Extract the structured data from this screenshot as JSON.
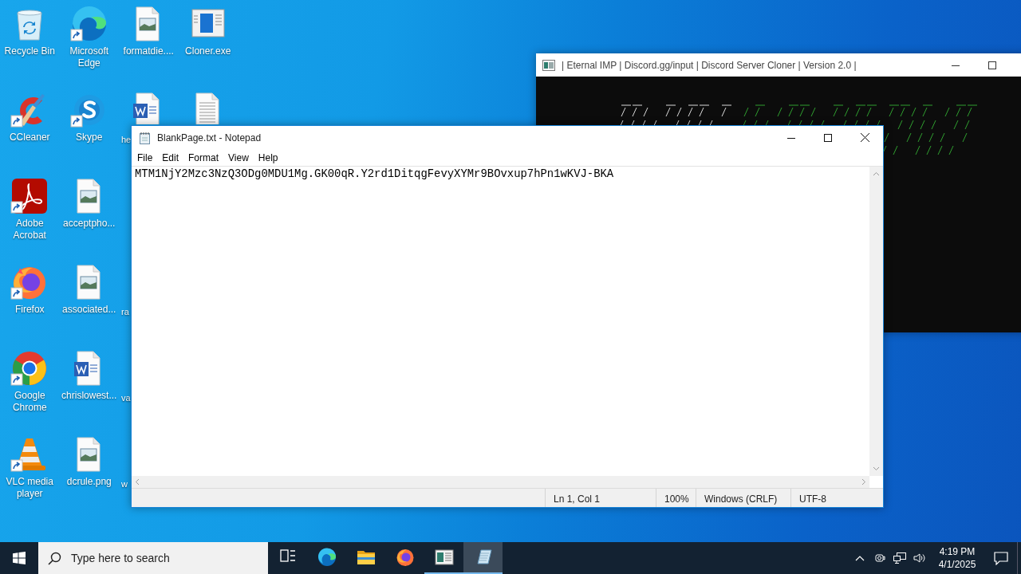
{
  "desktop": {
    "columns": [
      [
        {
          "label": "Recycle Bin",
          "kind": "recycle",
          "shortcut": false,
          "clipped": false
        },
        {
          "label": "CCleaner",
          "kind": "ccleaner",
          "shortcut": true,
          "clipped": false
        },
        {
          "label": "Adobe Acrobat",
          "kind": "acrobat",
          "shortcut": true,
          "clipped": false
        },
        {
          "label": "Firefox",
          "kind": "firefox",
          "shortcut": true,
          "clipped": false
        },
        {
          "label": "Google Chrome",
          "kind": "chrome",
          "shortcut": true,
          "clipped": false
        },
        {
          "label": "VLC media player",
          "kind": "vlc",
          "shortcut": true,
          "clipped": false
        }
      ],
      [
        {
          "label": "Microsoft Edge",
          "kind": "edge",
          "shortcut": true,
          "clipped": false
        },
        {
          "label": "Skype",
          "kind": "skype",
          "shortcut": true,
          "clipped": false
        },
        {
          "label": "acceptpho...",
          "kind": "image",
          "shortcut": false,
          "clipped": false
        },
        {
          "label": "associated...",
          "kind": "image",
          "shortcut": false,
          "clipped": false
        },
        {
          "label": "chrislowest...",
          "kind": "word",
          "shortcut": false,
          "clipped": false
        },
        {
          "label": "dcrule.png",
          "kind": "image",
          "shortcut": false,
          "clipped": false
        }
      ],
      [
        {
          "label": "formatdie....",
          "kind": "image",
          "shortcut": false,
          "clipped": false
        },
        {
          "label": "he",
          "kind": "word",
          "shortcut": false,
          "clipped": true
        },
        null,
        {
          "label": "ra",
          "kind": "none",
          "clipped": true
        },
        {
          "label": "va",
          "kind": "none",
          "clipped": true
        },
        {
          "label": "w",
          "kind": "none",
          "clipped": true
        }
      ],
      [
        {
          "label": "Cloner.exe",
          "kind": "exe",
          "shortcut": false,
          "clipped": false
        },
        {
          "kind": "text",
          "shortcut": false,
          "clipped": true
        }
      ]
    ]
  },
  "console_window": {
    "title": "| Eternal IMP | Discord.gg/input | Discord Server Cloner | Version 2.0 |"
  },
  "notepad": {
    "title": "BlankPage.txt - Notepad",
    "menu": [
      "File",
      "Edit",
      "Format",
      "View",
      "Help"
    ],
    "content": "MTM1NjY2Mzc3NzQ3ODg0MDU1Mg.GK00qR.Y2rd1DitqgFevyXYMr9BOvxup7hPn1wKVJ-BKA",
    "status": [
      "Ln 1, Col 1",
      "100%",
      "Windows (CRLF)",
      "UTF-8"
    ]
  },
  "taskbar": {
    "search": {
      "placeholder": "Type here to search"
    },
    "apps": [
      {
        "kind": "taskview",
        "running": false,
        "active": false
      },
      {
        "kind": "edge",
        "running": false,
        "active": false
      },
      {
        "kind": "folder",
        "running": false,
        "active": false
      },
      {
        "kind": "firefox",
        "running": false,
        "active": false
      },
      {
        "kind": "console",
        "running": true,
        "active": false
      },
      {
        "kind": "notepad",
        "running": true,
        "active": true
      }
    ],
    "clock": {
      "time": "4:19 PM",
      "date": "4/1/2025"
    }
  }
}
